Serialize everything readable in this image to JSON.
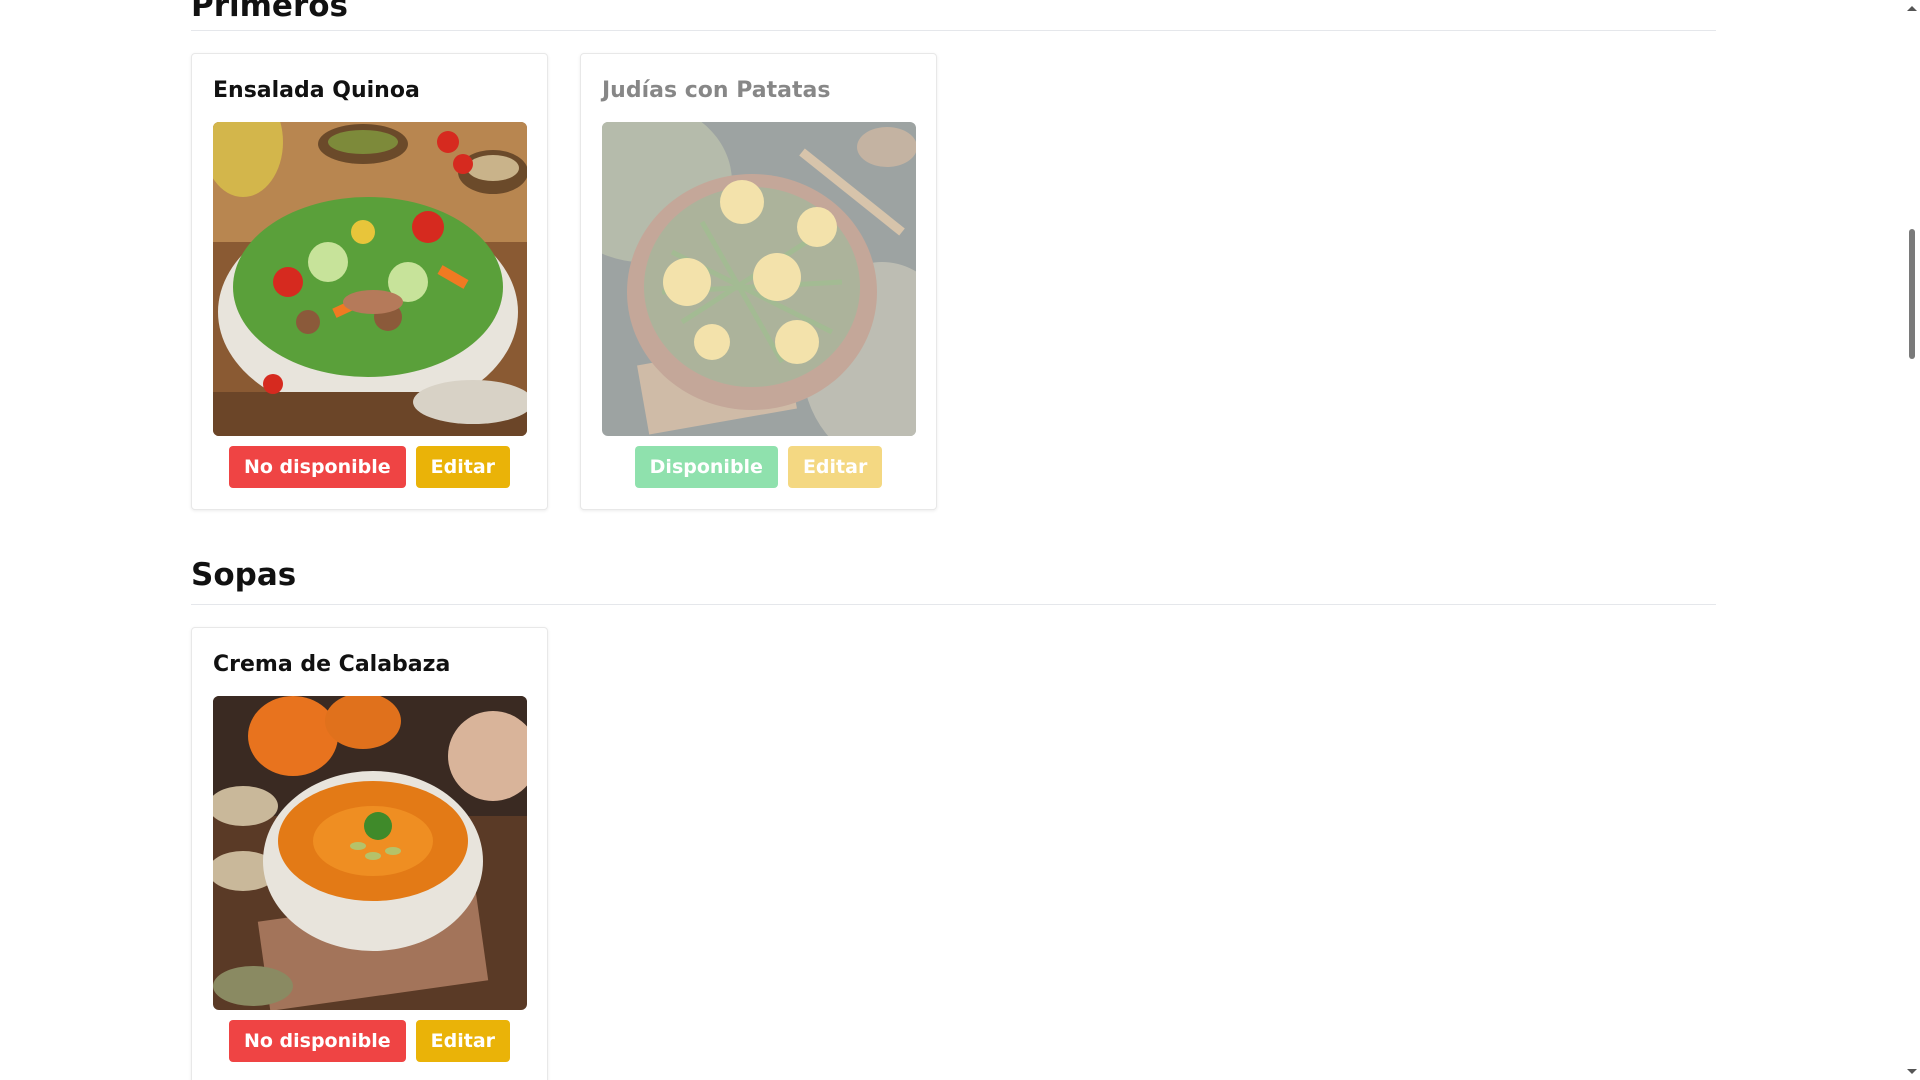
{
  "sections": [
    {
      "title": "Primeros",
      "dishes": [
        {
          "name": "Ensalada Quinoa",
          "image": "quinoa-salad-photo",
          "status_label": "No disponible",
          "status_color": "#ef4444",
          "edit_label": "Editar",
          "available": true
        },
        {
          "name": "Judías con Patatas",
          "image": "green-beans-potatoes-photo",
          "status_label": "Disponible",
          "status_color": "#22c55e",
          "edit_label": "Editar",
          "available": false
        }
      ]
    },
    {
      "title": "Sopas",
      "dishes": [
        {
          "name": "Crema de Calabaza",
          "image": "pumpkin-soup-photo",
          "status_label": "No disponible",
          "status_color": "#ef4444",
          "edit_label": "Editar",
          "available": true
        }
      ]
    }
  ],
  "colors": {
    "edit": "#eab308",
    "rule": "#e5e7eb"
  }
}
